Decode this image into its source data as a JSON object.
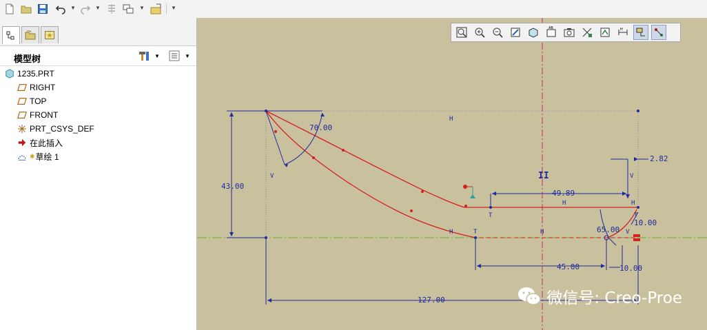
{
  "model_tree": {
    "title": "模型树",
    "items": [
      {
        "label": "1235.PRT",
        "icon": "part-icon"
      },
      {
        "label": "RIGHT",
        "icon": "datum-plane-icon"
      },
      {
        "label": "TOP",
        "icon": "datum-plane-icon"
      },
      {
        "label": "FRONT",
        "icon": "datum-plane-icon"
      },
      {
        "label": "PRT_CSYS_DEF",
        "icon": "csys-icon"
      },
      {
        "label": "在此插入",
        "icon": "insert-here-arrow-icon"
      },
      {
        "label": "草绘 1",
        "icon": "sketch-icon"
      }
    ]
  },
  "sketch": {
    "dimensions": {
      "angle_top": "70.00",
      "height_left": "43.00",
      "offset_right": "2.82",
      "length_upper": "49.89",
      "angle_right": "65.00",
      "radius_right": "10.00",
      "length_lower": "45.00",
      "small_lower": "10.00",
      "total_length": "127.00"
    },
    "constraints": {
      "h": "H",
      "v": "V",
      "t": "T",
      "parallel": "II"
    }
  },
  "watermark": {
    "text": "微信号: Creo-Proe"
  },
  "colors": {
    "viewport_bg": "#c9c19d",
    "dimension": "#1e2aa0",
    "curve": "#d42020",
    "centerline": "#c0306a",
    "green_axis": "#6ab030"
  }
}
